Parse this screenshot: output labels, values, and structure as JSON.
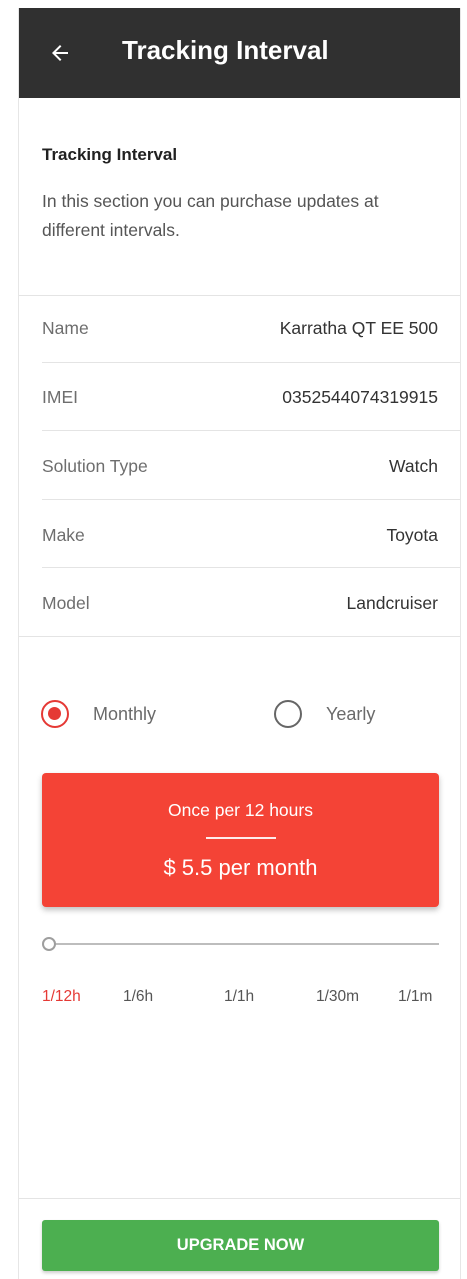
{
  "appbar": {
    "title": "Tracking Interval",
    "back_icon": "arrow-left-icon",
    "background": "#303030"
  },
  "intro": {
    "title": "Tracking Interval",
    "text": "In this section you can purchase updates at different intervals."
  },
  "device_info": [
    {
      "label": "Name",
      "value": "Karratha QT EE 500"
    },
    {
      "label": "IMEI",
      "value": "0352544074319915"
    },
    {
      "label": "Solution Type",
      "value": "Watch"
    },
    {
      "label": "Make",
      "value": "Toyota"
    },
    {
      "label": "Model",
      "value": "Landcruiser"
    }
  ],
  "billing": {
    "options": [
      {
        "label": "Monthly",
        "selected": true
      },
      {
        "label": "Yearly",
        "selected": false
      }
    ]
  },
  "plan": {
    "frequency": "Once per 12 hours",
    "price": "$ 5.5 per month",
    "color": "#f44336"
  },
  "slider": {
    "value_index": 0,
    "ticks": [
      "1/12h",
      "1/6h",
      "1/1h",
      "1/30m",
      "1/1m"
    ],
    "active_color": "#e53935"
  },
  "upgrade_button": {
    "label": "UPGRADE NOW",
    "color": "#4caf50"
  }
}
